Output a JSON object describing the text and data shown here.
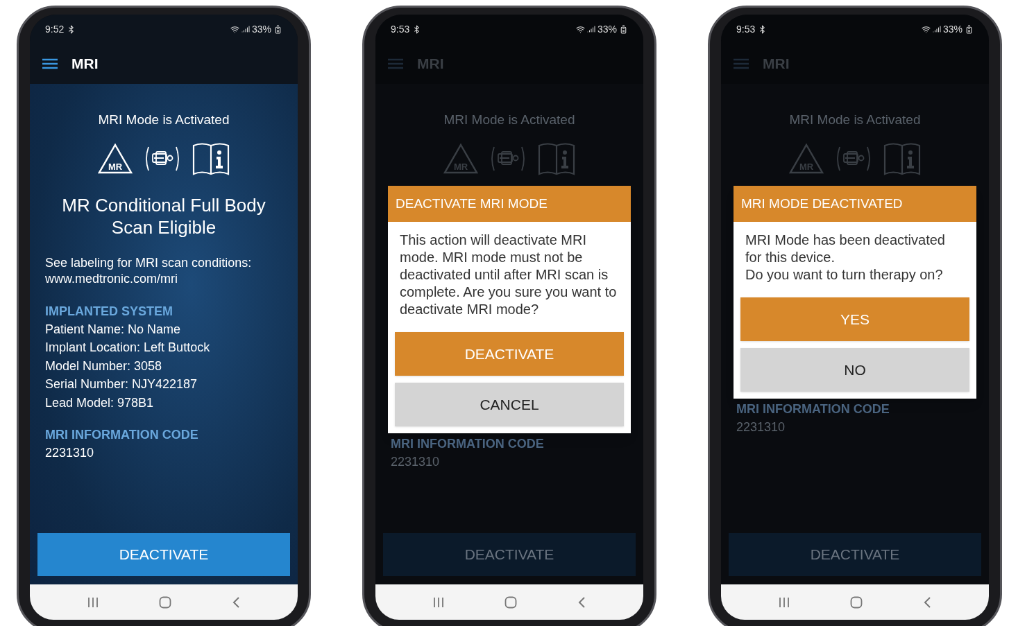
{
  "phones": [
    {
      "time": "9:52",
      "battery": "33%",
      "title": "MRI",
      "dimmed": false,
      "status": "MRI Mode is Activated",
      "mr_label": "MR",
      "eligibility": "MR Conditional Full Body Scan Eligible",
      "labeling": [
        "See labeling for MRI scan conditions:",
        "www.medtronic.com/mri"
      ],
      "implanted_system": {
        "title": "IMPLANTED SYSTEM",
        "lines": [
          "Patient Name: No Name",
          "Implant Location: Left Buttock",
          "Model Number: 3058",
          "Serial Number: NJY422187",
          "Lead Model: 978B1"
        ]
      },
      "info_code": {
        "title": "MRI INFORMATION CODE",
        "value": "2231310"
      },
      "action": "DEACTIVATE"
    },
    {
      "time": "9:53",
      "battery": "33%",
      "title": "MRI",
      "dimmed": true,
      "status": "MRI Mode is Activated",
      "mr_label": "MR",
      "dialog": {
        "title": "DEACTIVATE MRI MODE",
        "message": [
          "This action will deactivate MRI mode. MRI mode must not be deactivated until after MRI scan is complete. Are you sure you want to deactivate MRI mode?"
        ],
        "buttons": [
          {
            "label": "DEACTIVATE",
            "kind": "primary"
          },
          {
            "label": "CANCEL",
            "kind": "secondary"
          }
        ]
      },
      "info_code": {
        "title": "MRI INFORMATION CODE",
        "value": "2231310"
      },
      "action": "DEACTIVATE"
    },
    {
      "time": "9:53",
      "battery": "33%",
      "title": "MRI",
      "dimmed": true,
      "status": "MRI Mode is Activated",
      "mr_label": "MR",
      "dialog": {
        "title": "MRI MODE DEACTIVATED",
        "message": [
          "MRI Mode has been deactivated for this device.",
          "Do you want to turn therapy on?"
        ],
        "buttons": [
          {
            "label": "YES",
            "kind": "primary"
          },
          {
            "label": "NO",
            "kind": "secondary"
          }
        ]
      },
      "info_code": {
        "title": "MRI INFORMATION CODE",
        "value": "2231310"
      },
      "action": "DEACTIVATE"
    }
  ]
}
